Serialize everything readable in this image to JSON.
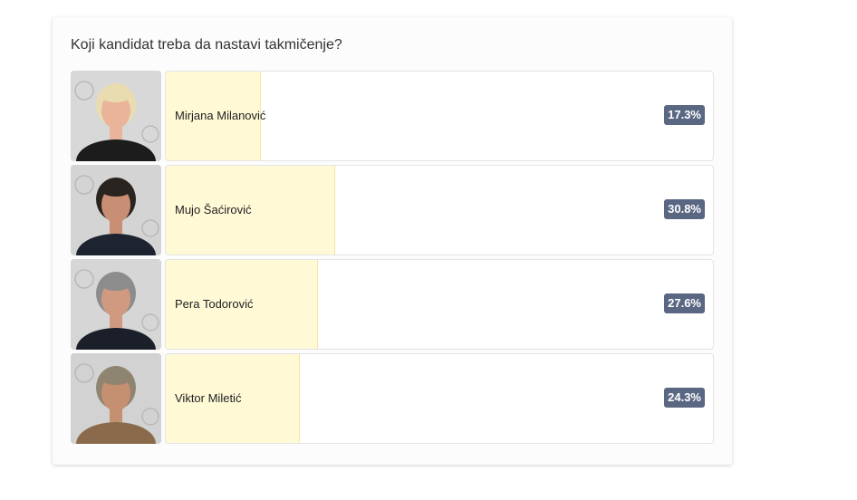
{
  "poll": {
    "question": "Koji kandidat treba da nastavi takmičenje?",
    "options": [
      {
        "name": "Mirjana Milanović",
        "percent_label": "17.3%",
        "percent": 17.3,
        "photo_bg": "#d8d8d8",
        "hair": "#e8dcb0",
        "skin": "#e9b49a",
        "clothes": "#1c1c1c"
      },
      {
        "name": "Mujo Šaćirović",
        "percent_label": "30.8%",
        "percent": 30.8,
        "photo_bg": "#d4d4d4",
        "hair": "#2a2420",
        "skin": "#c98f74",
        "clothes": "#1e2330"
      },
      {
        "name": "Pera Todorović",
        "percent_label": "27.6%",
        "percent": 27.6,
        "photo_bg": "#d6d6d6",
        "hair": "#8c8c8c",
        "skin": "#cf9a80",
        "clothes": "#1b1f2a"
      },
      {
        "name": "Viktor Miletić",
        "percent_label": "24.3%",
        "percent": 24.3,
        "photo_bg": "#d2d2d2",
        "hair": "#8f8470",
        "skin": "#c58f72",
        "clothes": "#8a6a4a"
      }
    ]
  },
  "colors": {
    "bar_fill": "#fff9d6",
    "badge": "#5a6782"
  }
}
